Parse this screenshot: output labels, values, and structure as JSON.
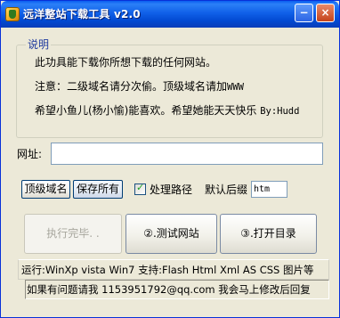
{
  "window": {
    "title": "远洋整站下载工具 v2.0",
    "minimize_glyph": "−",
    "close_glyph": "×"
  },
  "description": {
    "group_title": "说明",
    "line1": "此功具能下载你所想下载的任何网站。",
    "line2_prefix": "注意：二级域名请分次偷。顶级域名请加",
    "line2_suffix": "WWW",
    "line3_prefix": "希望小鱼儿(杨小愉)能喜欢。希望她能天天快乐 ",
    "line3_suffix": "By:Hudd"
  },
  "url": {
    "label": "网址:",
    "value": "",
    "placeholder": ""
  },
  "options": {
    "top_domain_label": "顶级域名",
    "save_all_label": "保存所有",
    "handle_path_label": "处理路径",
    "handle_path_checked": true,
    "default_suffix_label": "默认后缀",
    "default_suffix_value": "htm"
  },
  "actions": {
    "execute_label": "执行完毕. .",
    "test_label": "②.测试网站",
    "open_label": "③.打开目录"
  },
  "footer": {
    "status": "运行:WinXp vista Win7 支持:Flash Html Xml AS CSS 图片等",
    "contact": "如果有问题请我 1153951792@qq.com 我会马上修改后回复"
  }
}
